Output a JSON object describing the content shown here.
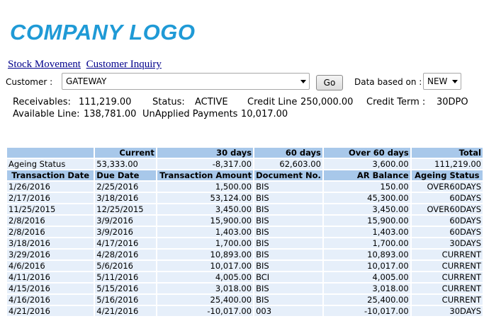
{
  "logo": "COMPANY LOGO",
  "nav": {
    "stock_movement": "Stock Movement",
    "customer_inquiry": "Customer Inquiry"
  },
  "filter": {
    "customer_label": "Customer :",
    "customer_value": "GATEWAY",
    "go_label": "Go",
    "data_based_label": "Data based on :",
    "data_based_value": "NEW"
  },
  "summary": {
    "receivables_label": "Receivables:",
    "receivables_value": "111,219.00",
    "status_label": "Status:",
    "status_value": "ACTIVE",
    "credit_line_label": "Credit Line",
    "credit_line_value": "250,000.00",
    "credit_term_label": "Credit Term :",
    "credit_term_value": "30DPO",
    "available_line_label": "Available Line:",
    "available_line_value": "138,781.00",
    "unapplied_label": "UnApplied Payments",
    "unapplied_value": "10,017.00"
  },
  "ageing": {
    "headers": [
      "Current",
      "30 days",
      "60 days",
      "Over 60 days",
      "Total"
    ],
    "row_label": "Ageing Status",
    "values": [
      "53,333.00",
      "-8,317.00",
      "62,603.00",
      "3,600.00",
      "111,219.00"
    ]
  },
  "transactions": {
    "headers": [
      "Transaction Date",
      "Due Date",
      "Transaction Amount",
      "Document No.",
      "AR Balance",
      "Ageing Status"
    ],
    "rows": [
      [
        "1/26/2016",
        "2/25/2016",
        "1,500.00",
        "BIS",
        "150.00",
        "OVER60DAYS"
      ],
      [
        "2/17/2016",
        "3/18/2016",
        "53,124.00",
        "BIS",
        "45,300.00",
        "60DAYS"
      ],
      [
        "11/25/2015",
        "12/25/2015",
        "3,450.00",
        "BIS",
        "3,450.00",
        "OVER60DAYS"
      ],
      [
        "2/8/2016",
        "3/9/2016",
        "15,900.00",
        "BIS",
        "15,900.00",
        "60DAYS"
      ],
      [
        "2/8/2016",
        "3/9/2016",
        "1,403.00",
        "BIS",
        "1,403.00",
        "60DAYS"
      ],
      [
        "3/18/2016",
        "4/17/2016",
        "1,700.00",
        "BIS",
        "1,700.00",
        "30DAYS"
      ],
      [
        "3/29/2016",
        "4/28/2016",
        "10,893.00",
        "BIS",
        "10,893.00",
        "CURRENT"
      ],
      [
        "4/6/2016",
        "5/6/2016",
        "10,017.00",
        "BIS",
        "10,017.00",
        "CURRENT"
      ],
      [
        "4/11/2016",
        "5/11/2016",
        "4,005.00",
        "BCI",
        "4,005.00",
        "CURRENT"
      ],
      [
        "4/15/2016",
        "5/15/2016",
        "3,018.00",
        "BIS",
        "3,018.00",
        "CURRENT"
      ],
      [
        "4/16/2016",
        "5/16/2016",
        "25,400.00",
        "BIS",
        "25,400.00",
        "CURRENT"
      ],
      [
        "4/21/2016",
        "4/21/2016",
        "-10,017.00",
        "003",
        "-10,017.00",
        "30DAYS"
      ]
    ]
  }
}
